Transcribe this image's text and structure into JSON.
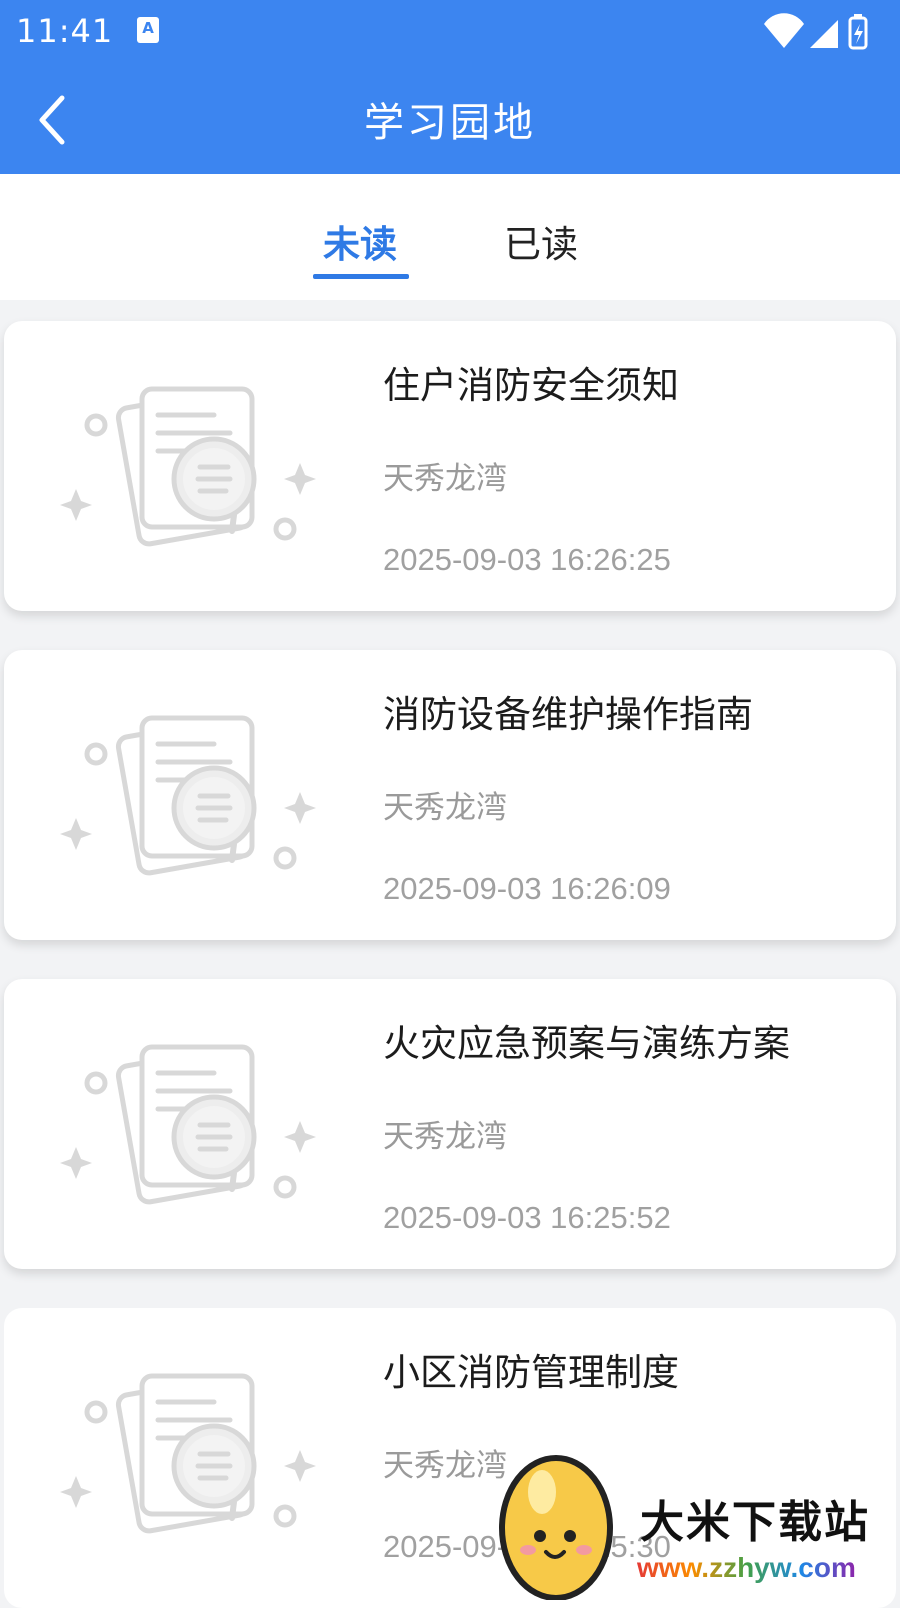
{
  "status_bar": {
    "time": "11:41",
    "notification_badge": "A",
    "icons": [
      "wifi-icon",
      "signal-icon",
      "battery-charging-icon"
    ]
  },
  "header": {
    "title": "学习园地",
    "back_icon": "chevron-left-icon"
  },
  "tabs": [
    {
      "label": "未读",
      "active": true
    },
    {
      "label": "已读",
      "active": false
    }
  ],
  "articles": [
    {
      "title": "住户消防安全须知",
      "community": "天秀龙湾",
      "time": "2025-09-03 16:26:25",
      "thumbnail_icon": "document-search-icon"
    },
    {
      "title": "消防设备维护操作指南",
      "community": "天秀龙湾",
      "time": "2025-09-03 16:26:09",
      "thumbnail_icon": "document-search-icon"
    },
    {
      "title": "火灾应急预案与演练方案",
      "community": "天秀龙湾",
      "time": "2025-09-03 16:25:52",
      "thumbnail_icon": "document-search-icon"
    },
    {
      "title": "小区消防管理制度",
      "community": "天秀龙湾",
      "time": "2025-09-03 16:25:30",
      "thumbnail_icon": "document-search-icon"
    }
  ],
  "watermark": {
    "name": "大米下载站",
    "url": "www.zzhyw.com"
  },
  "colors": {
    "primary": "#3c85f0",
    "tab_active": "#2f7ae5",
    "title_text": "#1c1c1c",
    "secondary_text": "#9a9a9a",
    "background": "#f2f3f5"
  }
}
